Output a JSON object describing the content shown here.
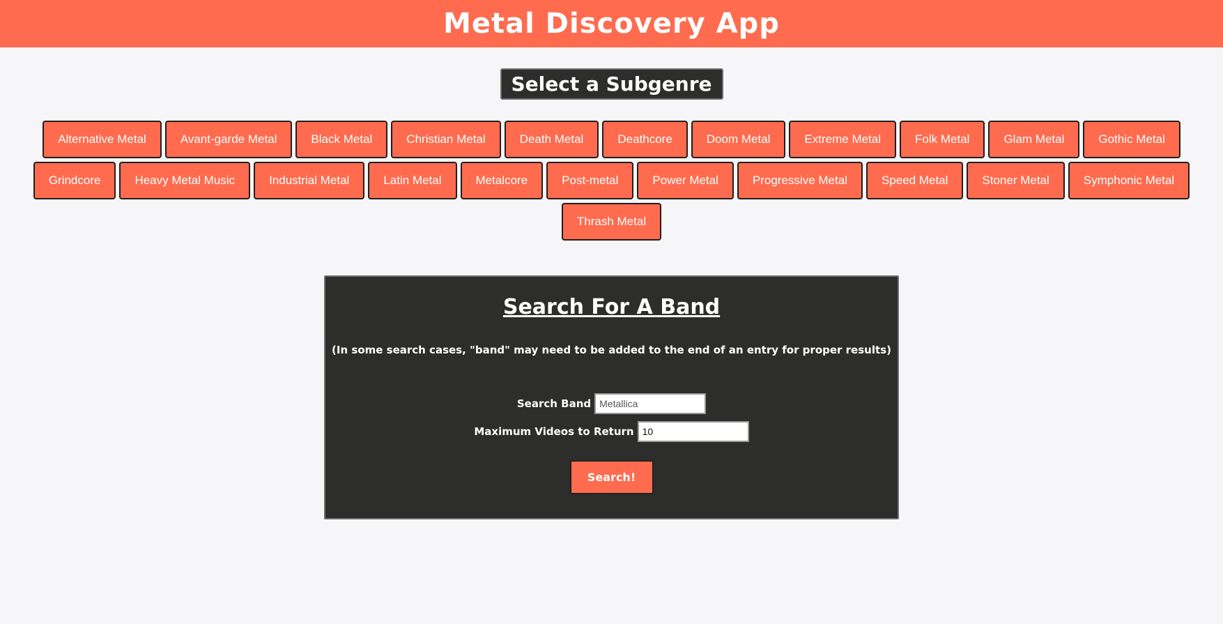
{
  "header": {
    "title": "Metal Discovery App"
  },
  "subgenres": {
    "heading": "Select a Subgenre",
    "items": [
      "Alternative Metal",
      "Avant-garde Metal",
      "Black Metal",
      "Christian Metal",
      "Death Metal",
      "Deathcore",
      "Doom Metal",
      "Extreme Metal",
      "Folk Metal",
      "Glam Metal",
      "Gothic Metal",
      "Grindcore",
      "Heavy Metal Music",
      "Industrial Metal",
      "Latin Metal",
      "Metalcore",
      "Post-metal",
      "Power Metal",
      "Progressive Metal",
      "Speed Metal",
      "Stoner Metal",
      "Symphonic Metal",
      "Thrash Metal"
    ]
  },
  "search": {
    "title": "Search For A Band",
    "note": "(In some search cases, \"band\" may need to be added to the end of an entry for proper results)",
    "band_label": "Search Band",
    "band_value": "Metallica",
    "max_videos_label": "Maximum Videos to Return",
    "max_videos_value": "10",
    "button_label": "Search!"
  },
  "colors": {
    "accent": "#ff6b4e",
    "panel": "#2d2e2c",
    "background": "#f6f6f8"
  }
}
